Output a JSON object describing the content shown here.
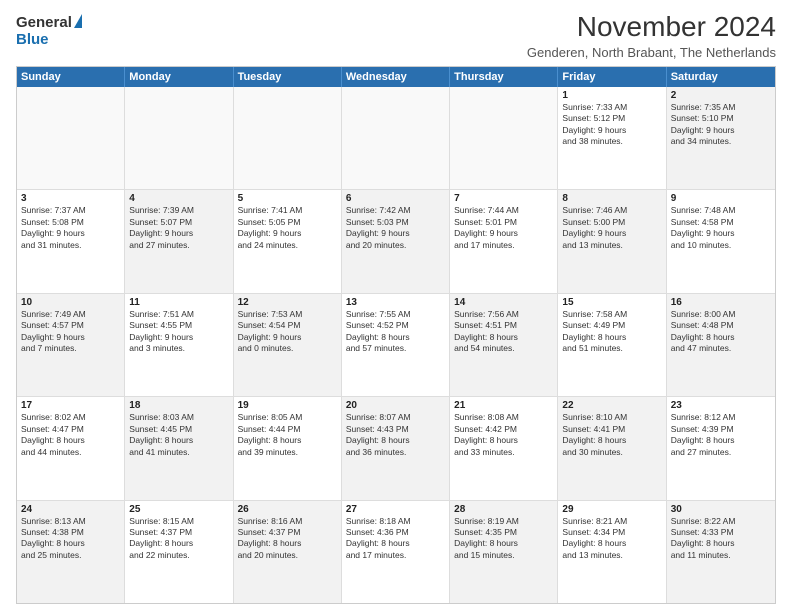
{
  "logo": {
    "general": "General",
    "blue": "Blue"
  },
  "title": "November 2024",
  "subtitle": "Genderen, North Brabant, The Netherlands",
  "header_days": [
    "Sunday",
    "Monday",
    "Tuesday",
    "Wednesday",
    "Thursday",
    "Friday",
    "Saturday"
  ],
  "weeks": [
    [
      {
        "day": "",
        "info": "",
        "empty": true
      },
      {
        "day": "",
        "info": "",
        "empty": true
      },
      {
        "day": "",
        "info": "",
        "empty": true
      },
      {
        "day": "",
        "info": "",
        "empty": true
      },
      {
        "day": "",
        "info": "",
        "empty": true
      },
      {
        "day": "1",
        "info": "Sunrise: 7:33 AM\nSunset: 5:12 PM\nDaylight: 9 hours\nand 38 minutes.",
        "empty": false,
        "shaded": false
      },
      {
        "day": "2",
        "info": "Sunrise: 7:35 AM\nSunset: 5:10 PM\nDaylight: 9 hours\nand 34 minutes.",
        "empty": false,
        "shaded": true
      }
    ],
    [
      {
        "day": "3",
        "info": "Sunrise: 7:37 AM\nSunset: 5:08 PM\nDaylight: 9 hours\nand 31 minutes.",
        "empty": false,
        "shaded": false
      },
      {
        "day": "4",
        "info": "Sunrise: 7:39 AM\nSunset: 5:07 PM\nDaylight: 9 hours\nand 27 minutes.",
        "empty": false,
        "shaded": true
      },
      {
        "day": "5",
        "info": "Sunrise: 7:41 AM\nSunset: 5:05 PM\nDaylight: 9 hours\nand 24 minutes.",
        "empty": false,
        "shaded": false
      },
      {
        "day": "6",
        "info": "Sunrise: 7:42 AM\nSunset: 5:03 PM\nDaylight: 9 hours\nand 20 minutes.",
        "empty": false,
        "shaded": true
      },
      {
        "day": "7",
        "info": "Sunrise: 7:44 AM\nSunset: 5:01 PM\nDaylight: 9 hours\nand 17 minutes.",
        "empty": false,
        "shaded": false
      },
      {
        "day": "8",
        "info": "Sunrise: 7:46 AM\nSunset: 5:00 PM\nDaylight: 9 hours\nand 13 minutes.",
        "empty": false,
        "shaded": true
      },
      {
        "day": "9",
        "info": "Sunrise: 7:48 AM\nSunset: 4:58 PM\nDaylight: 9 hours\nand 10 minutes.",
        "empty": false,
        "shaded": false
      }
    ],
    [
      {
        "day": "10",
        "info": "Sunrise: 7:49 AM\nSunset: 4:57 PM\nDaylight: 9 hours\nand 7 minutes.",
        "empty": false,
        "shaded": true
      },
      {
        "day": "11",
        "info": "Sunrise: 7:51 AM\nSunset: 4:55 PM\nDaylight: 9 hours\nand 3 minutes.",
        "empty": false,
        "shaded": false
      },
      {
        "day": "12",
        "info": "Sunrise: 7:53 AM\nSunset: 4:54 PM\nDaylight: 9 hours\nand 0 minutes.",
        "empty": false,
        "shaded": true
      },
      {
        "day": "13",
        "info": "Sunrise: 7:55 AM\nSunset: 4:52 PM\nDaylight: 8 hours\nand 57 minutes.",
        "empty": false,
        "shaded": false
      },
      {
        "day": "14",
        "info": "Sunrise: 7:56 AM\nSunset: 4:51 PM\nDaylight: 8 hours\nand 54 minutes.",
        "empty": false,
        "shaded": true
      },
      {
        "day": "15",
        "info": "Sunrise: 7:58 AM\nSunset: 4:49 PM\nDaylight: 8 hours\nand 51 minutes.",
        "empty": false,
        "shaded": false
      },
      {
        "day": "16",
        "info": "Sunrise: 8:00 AM\nSunset: 4:48 PM\nDaylight: 8 hours\nand 47 minutes.",
        "empty": false,
        "shaded": true
      }
    ],
    [
      {
        "day": "17",
        "info": "Sunrise: 8:02 AM\nSunset: 4:47 PM\nDaylight: 8 hours\nand 44 minutes.",
        "empty": false,
        "shaded": false
      },
      {
        "day": "18",
        "info": "Sunrise: 8:03 AM\nSunset: 4:45 PM\nDaylight: 8 hours\nand 41 minutes.",
        "empty": false,
        "shaded": true
      },
      {
        "day": "19",
        "info": "Sunrise: 8:05 AM\nSunset: 4:44 PM\nDaylight: 8 hours\nand 39 minutes.",
        "empty": false,
        "shaded": false
      },
      {
        "day": "20",
        "info": "Sunrise: 8:07 AM\nSunset: 4:43 PM\nDaylight: 8 hours\nand 36 minutes.",
        "empty": false,
        "shaded": true
      },
      {
        "day": "21",
        "info": "Sunrise: 8:08 AM\nSunset: 4:42 PM\nDaylight: 8 hours\nand 33 minutes.",
        "empty": false,
        "shaded": false
      },
      {
        "day": "22",
        "info": "Sunrise: 8:10 AM\nSunset: 4:41 PM\nDaylight: 8 hours\nand 30 minutes.",
        "empty": false,
        "shaded": true
      },
      {
        "day": "23",
        "info": "Sunrise: 8:12 AM\nSunset: 4:39 PM\nDaylight: 8 hours\nand 27 minutes.",
        "empty": false,
        "shaded": false
      }
    ],
    [
      {
        "day": "24",
        "info": "Sunrise: 8:13 AM\nSunset: 4:38 PM\nDaylight: 8 hours\nand 25 minutes.",
        "empty": false,
        "shaded": true
      },
      {
        "day": "25",
        "info": "Sunrise: 8:15 AM\nSunset: 4:37 PM\nDaylight: 8 hours\nand 22 minutes.",
        "empty": false,
        "shaded": false
      },
      {
        "day": "26",
        "info": "Sunrise: 8:16 AM\nSunset: 4:37 PM\nDaylight: 8 hours\nand 20 minutes.",
        "empty": false,
        "shaded": true
      },
      {
        "day": "27",
        "info": "Sunrise: 8:18 AM\nSunset: 4:36 PM\nDaylight: 8 hours\nand 17 minutes.",
        "empty": false,
        "shaded": false
      },
      {
        "day": "28",
        "info": "Sunrise: 8:19 AM\nSunset: 4:35 PM\nDaylight: 8 hours\nand 15 minutes.",
        "empty": false,
        "shaded": true
      },
      {
        "day": "29",
        "info": "Sunrise: 8:21 AM\nSunset: 4:34 PM\nDaylight: 8 hours\nand 13 minutes.",
        "empty": false,
        "shaded": false
      },
      {
        "day": "30",
        "info": "Sunrise: 8:22 AM\nSunset: 4:33 PM\nDaylight: 8 hours\nand 11 minutes.",
        "empty": false,
        "shaded": true
      }
    ]
  ]
}
